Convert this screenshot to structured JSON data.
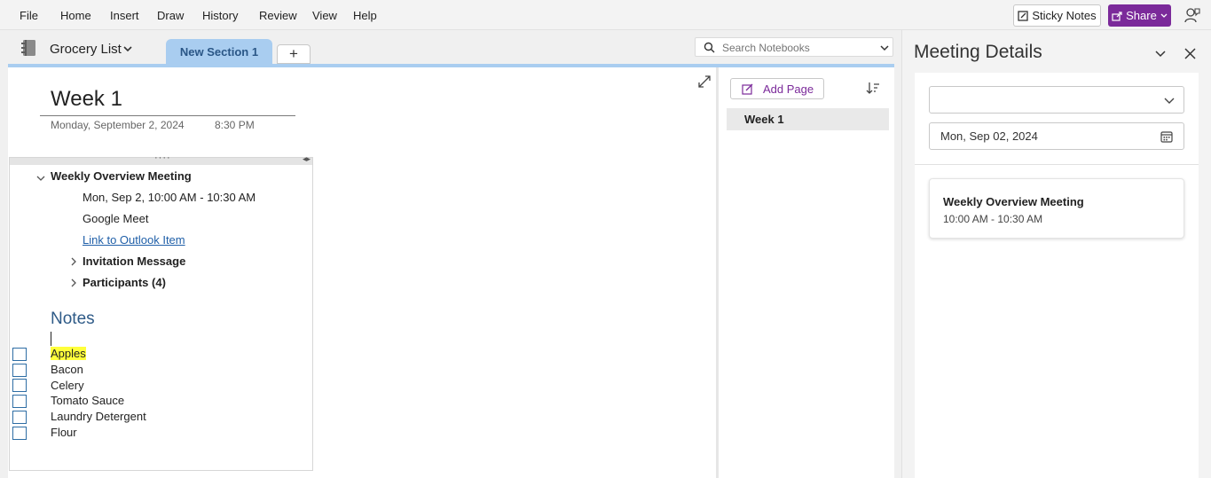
{
  "menubar": {
    "items": [
      "File",
      "Home",
      "Insert",
      "Draw",
      "History",
      "Review",
      "View",
      "Help"
    ],
    "sticky_notes_label": "Sticky Notes",
    "share_label": "Share",
    "share_color": "#7b2a9a"
  },
  "notebook": {
    "name": "Grocery List",
    "section_tab": "New Section 1",
    "add_section_label": "+",
    "search_placeholder": "Search Notebooks"
  },
  "page": {
    "title": "Week 1",
    "date": "Monday, September 2, 2024",
    "time": "8:30 PM",
    "meeting": {
      "title": "Weekly Overview Meeting",
      "when": "Mon, Sep 2, 10:00 AM - 10:30 AM",
      "location": "Google Meet",
      "outlook_link": "Link to Outlook Item",
      "invitation_label": "Invitation Message",
      "participants_label": "Participants (4)"
    },
    "notes_heading": "Notes",
    "checklist": [
      {
        "label": "Apples",
        "highlighted": true
      },
      {
        "label": "Bacon",
        "highlighted": false
      },
      {
        "label": "Celery",
        "highlighted": false
      },
      {
        "label": "Tomato Sauce",
        "highlighted": false
      },
      {
        "label": "Laundry Detergent",
        "highlighted": false
      },
      {
        "label": "Flour",
        "highlighted": false
      }
    ]
  },
  "pagelist": {
    "add_page_label": "Add Page",
    "pages": [
      "Week 1"
    ]
  },
  "meeting_details": {
    "title": "Meeting Details",
    "select_value": "",
    "date_value": "Mon, Sep 02, 2024",
    "card_title": "Weekly Overview Meeting",
    "card_time": "10:00 AM - 10:30 AM"
  }
}
